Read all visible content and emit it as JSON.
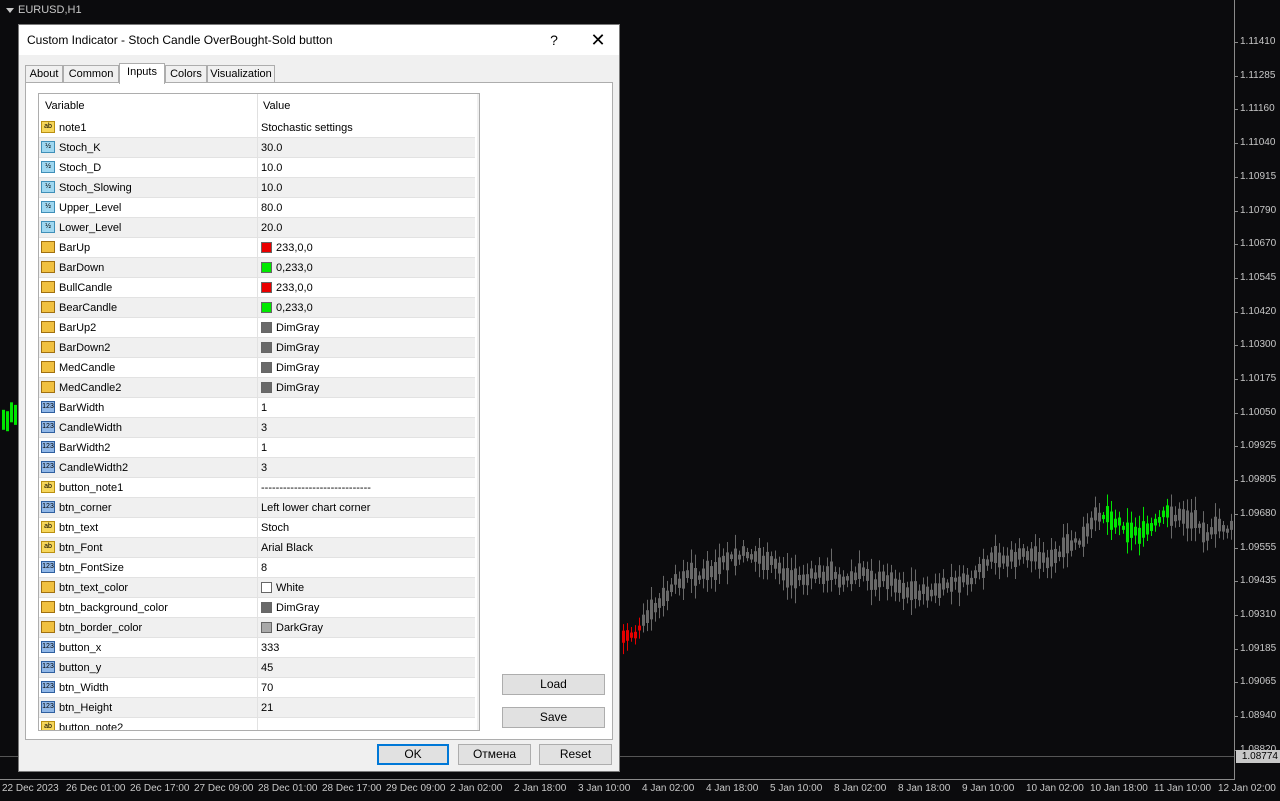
{
  "chart": {
    "symbol_label": "EURUSD,H1",
    "price_labels": [
      "1.11410",
      "1.11285",
      "1.11160",
      "1.11040",
      "1.10915",
      "1.10790",
      "1.10670",
      "1.10545",
      "1.10420",
      "1.10300",
      "1.10175",
      "1.10050",
      "1.09925",
      "1.09805",
      "1.09680",
      "1.09555",
      "1.09435",
      "1.09310",
      "1.09185",
      "1.09065",
      "1.08940",
      "1.08820"
    ],
    "current_price": "1.08774",
    "time_labels": [
      "22 Dec 2023",
      "26 Dec 01:00",
      "26 Dec 17:00",
      "27 Dec 09:00",
      "28 Dec 01:00",
      "28 Dec 17:00",
      "29 Dec 09:00",
      "2 Jan 02:00",
      "2 Jan 18:00",
      "3 Jan 10:00",
      "4 Jan 02:00",
      "4 Jan 18:00",
      "5 Jan 10:00",
      "8 Jan 02:00",
      "8 Jan 18:00",
      "9 Jan 10:00",
      "10 Jan 02:00",
      "10 Jan 18:00",
      "11 Jan 10:00",
      "12 Jan 02:00"
    ],
    "colors": {
      "up": "#00e600",
      "down": "#e60000",
      "neutral": "#696969"
    }
  },
  "dialog": {
    "title": "Custom Indicator - Stoch Candle OverBought-Sold button",
    "help_glyph": "?",
    "close_glyph": "✕",
    "tabs": [
      "About",
      "Common",
      "Inputs",
      "Colors",
      "Visualization"
    ],
    "active_tab": "Inputs",
    "grid": {
      "header_variable": "Variable",
      "header_value": "Value",
      "rows": [
        {
          "icon": "ab",
          "icon_text": "ab",
          "variable": "note1",
          "value": "Stochastic settings"
        },
        {
          "icon": "dbl",
          "icon_text": "½",
          "variable": "Stoch_K",
          "value": "30.0"
        },
        {
          "icon": "dbl",
          "icon_text": "½",
          "variable": "Stoch_D",
          "value": "10.0"
        },
        {
          "icon": "dbl",
          "icon_text": "½",
          "variable": "Stoch_Slowing",
          "value": "10.0"
        },
        {
          "icon": "dbl",
          "icon_text": "½",
          "variable": "Upper_Level",
          "value": "80.0"
        },
        {
          "icon": "dbl",
          "icon_text": "½",
          "variable": "Lower_Level",
          "value": "20.0"
        },
        {
          "icon": "clr",
          "icon_text": "",
          "variable": "BarUp",
          "value": "233,0,0",
          "swatch": "#e90000"
        },
        {
          "icon": "clr",
          "icon_text": "",
          "variable": "BarDown",
          "value": "0,233,0",
          "swatch": "#00e900"
        },
        {
          "icon": "clr",
          "icon_text": "",
          "variable": "BullCandle",
          "value": "233,0,0",
          "swatch": "#e90000"
        },
        {
          "icon": "clr",
          "icon_text": "",
          "variable": "BearCandle",
          "value": "0,233,0",
          "swatch": "#00e900"
        },
        {
          "icon": "clr",
          "icon_text": "",
          "variable": "BarUp2",
          "value": "DimGray",
          "swatch": "#696969"
        },
        {
          "icon": "clr",
          "icon_text": "",
          "variable": "BarDown2",
          "value": "DimGray",
          "swatch": "#696969"
        },
        {
          "icon": "clr",
          "icon_text": "",
          "variable": "MedCandle",
          "value": "DimGray",
          "swatch": "#696969"
        },
        {
          "icon": "clr",
          "icon_text": "",
          "variable": "MedCandle2",
          "value": "DimGray",
          "swatch": "#696969"
        },
        {
          "icon": "int",
          "icon_text": "123",
          "variable": "BarWidth",
          "value": "1"
        },
        {
          "icon": "int",
          "icon_text": "123",
          "variable": "CandleWidth",
          "value": "3"
        },
        {
          "icon": "int",
          "icon_text": "123",
          "variable": "BarWidth2",
          "value": "1"
        },
        {
          "icon": "int",
          "icon_text": "123",
          "variable": "CandleWidth2",
          "value": "3"
        },
        {
          "icon": "ab",
          "icon_text": "ab",
          "variable": "button_note1",
          "value": "------------------------------"
        },
        {
          "icon": "int",
          "icon_text": "123",
          "variable": "btn_corner",
          "value": "Left lower chart corner"
        },
        {
          "icon": "ab",
          "icon_text": "ab",
          "variable": "btn_text",
          "value": "Stoch"
        },
        {
          "icon": "ab",
          "icon_text": "ab",
          "variable": "btn_Font",
          "value": "Arial Black"
        },
        {
          "icon": "int",
          "icon_text": "123",
          "variable": "btn_FontSize",
          "value": "8"
        },
        {
          "icon": "clr",
          "icon_text": "",
          "variable": "btn_text_color",
          "value": "White",
          "swatch": "#ffffff"
        },
        {
          "icon": "clr",
          "icon_text": "",
          "variable": "btn_background_color",
          "value": "DimGray",
          "swatch": "#696969"
        },
        {
          "icon": "clr",
          "icon_text": "",
          "variable": "btn_border_color",
          "value": "DarkGray",
          "swatch": "#a9a9a9"
        },
        {
          "icon": "int",
          "icon_text": "123",
          "variable": "button_x",
          "value": "333"
        },
        {
          "icon": "int",
          "icon_text": "123",
          "variable": "button_y",
          "value": "45"
        },
        {
          "icon": "int",
          "icon_text": "123",
          "variable": "btn_Width",
          "value": "70"
        },
        {
          "icon": "int",
          "icon_text": "123",
          "variable": "btn_Height",
          "value": "21"
        },
        {
          "icon": "ab",
          "icon_text": "ab",
          "variable": "button_note2",
          "value": ""
        }
      ]
    },
    "buttons": {
      "load": "Load",
      "save": "Save",
      "ok": "OK",
      "cancel": "Отмена",
      "reset": "Reset"
    }
  }
}
